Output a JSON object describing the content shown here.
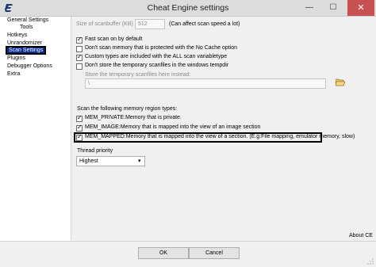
{
  "window": {
    "title": "Cheat Engine settings",
    "minimize_glyph": "—",
    "maximize_glyph": "☐",
    "close_glyph": "✕"
  },
  "tree": {
    "items": [
      {
        "label": "General Settings"
      },
      {
        "label": "Tools"
      },
      {
        "label": "Hotkeys"
      },
      {
        "label": "Unrandomizer"
      },
      {
        "label": "Scan Settings"
      },
      {
        "label": "Plugins"
      },
      {
        "label": "Debugger Options"
      },
      {
        "label": "Extra"
      }
    ]
  },
  "scan_settings": {
    "scanbuffer_label": "Size of scanbuffer (KB) :",
    "scanbuffer_value": "512",
    "scanbuffer_note": "(Can affect scan speed a lot)",
    "options": [
      {
        "label": "Fast scan on by default",
        "checked": true
      },
      {
        "label": "Don't scan memory that is protected with the No Cache option",
        "checked": false
      },
      {
        "label": "Custom types are included with the ALL scan variabletype",
        "checked": true
      },
      {
        "label": "Don't store the temporary scanfiles in the windows tempdir",
        "checked": false
      }
    ],
    "tempdir_label": "Store the temporary scanfiles here instead:",
    "tempdir_value": "\\",
    "region_types_label": "Scan the following memory region types:",
    "region_types": [
      {
        "label": "MEM_PRIVATE:Memory that is private.",
        "checked": true
      },
      {
        "label": "MEM_IMAGE:Memory that is mapped into the view of an image section",
        "checked": true
      },
      {
        "label": "MEM_MAPPED:Memory that is mapped into the view of a section. (E.g:File mapping, emulator memory, slow)",
        "checked": true
      }
    ],
    "thread_priority_label": "Thread priority",
    "thread_priority_value": "Highest"
  },
  "footer": {
    "about_link": "About CE",
    "ok_label": "OK",
    "cancel_label": "Cancel"
  }
}
